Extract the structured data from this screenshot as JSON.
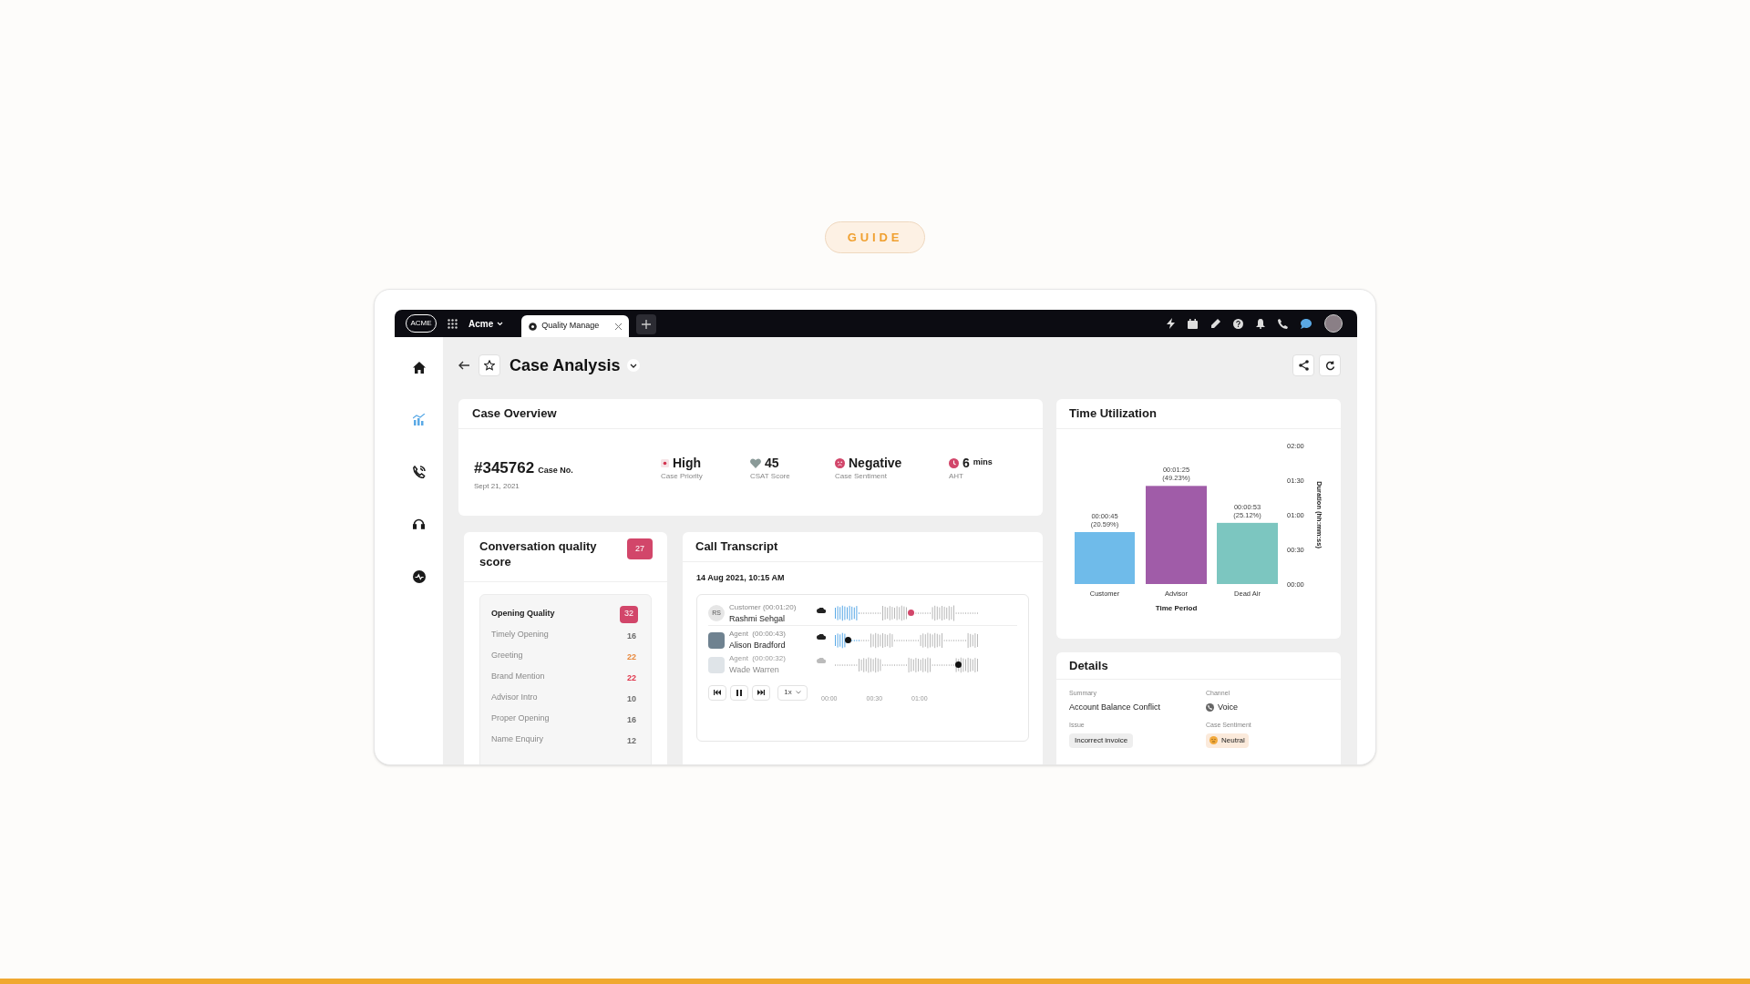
{
  "guide_badge": "GUIDE",
  "top_bar": {
    "logo": "ACME",
    "workspace": "Acme",
    "tabs": [
      {
        "label": "Quality Manage",
        "selected": true
      }
    ]
  },
  "sidebar": {
    "items": [
      {
        "kind": "home",
        "selected": false
      },
      {
        "kind": "chart",
        "selected": true
      },
      {
        "kind": "phone",
        "selected": false
      },
      {
        "kind": "headset",
        "selected": false
      },
      {
        "kind": "activity",
        "selected": false
      }
    ]
  },
  "page_header": {
    "title": "Case Analysis"
  },
  "case_overview": {
    "title": "Case Overview",
    "case_number": "#345762",
    "case_number_label": "Case No.",
    "date": "Sept 21, 2021",
    "metrics": [
      {
        "kind": "priority",
        "value": "High",
        "label": "Case Priority"
      },
      {
        "kind": "csat",
        "value": "45",
        "label": "CSAT Score"
      },
      {
        "kind": "sentiment",
        "value": "Negative",
        "label": "Case Sentiment"
      },
      {
        "kind": "aht",
        "value": "6",
        "unit": "mins",
        "label": "AHT"
      }
    ]
  },
  "conversation_quality": {
    "title": "Conversation quality score",
    "score": "27",
    "group": {
      "name": "Opening Quality",
      "score": "32",
      "items": [
        {
          "name": "Timely Opening",
          "score": "16",
          "color": "#6b6b6b"
        },
        {
          "name": "Greeting",
          "score": "22",
          "color": "#e8873a"
        },
        {
          "name": "Brand Mention",
          "score": "22",
          "color": "#e0344a"
        },
        {
          "name": "Advisor Intro",
          "score": "10",
          "color": "#6b6b6b"
        },
        {
          "name": "Proper Opening",
          "score": "16",
          "color": "#6b6b6b"
        },
        {
          "name": "Name Enquiry",
          "score": "12",
          "color": "#6b6b6b"
        }
      ]
    }
  },
  "call_transcript": {
    "title": "Call Transcript",
    "date": "14 Aug 2021, 10:15 AM",
    "speakers": [
      {
        "kind": "initials",
        "initials": "RS",
        "role": "Customer (00:01:20)",
        "name": "Rashmi Sehgal",
        "dimmed": false,
        "level": 0.53,
        "color": "#d2466a"
      },
      {
        "kind": "photo",
        "role": "Agent  (00:00:43)",
        "name": "Alison Bradford",
        "dimmed": false,
        "level": 0.09,
        "color": "#111111"
      },
      {
        "kind": "photo",
        "role": "Agent  (00:00:32)",
        "name": "Wade Warren",
        "dimmed": true,
        "level": 0.86,
        "color": "#111111"
      }
    ],
    "speed": "1x",
    "ticks": [
      "00:00",
      "00:30",
      "01:00"
    ]
  },
  "time_utilization": {
    "title": "Time Utilization",
    "chart_data": {
      "type": "bar",
      "xlabel": "Time Period",
      "ylabel": "Duration (hh:mm:ss)",
      "categories": [
        "Customer",
        "Advisor",
        "Dead Air"
      ],
      "series": [
        {
          "values": [
            45,
            85,
            53
          ]
        }
      ],
      "colors": [
        "#6fbbea",
        "#a05ca8",
        "#7cc6c0"
      ],
      "ylim": [
        0,
        120
      ],
      "yticks": [
        {
          "value": 0,
          "label": "00:00"
        },
        {
          "value": 30,
          "label": "00:30"
        },
        {
          "value": 60,
          "label": "01:00"
        },
        {
          "value": 90,
          "label": "01:30"
        },
        {
          "value": 120,
          "label": "02:00"
        }
      ],
      "value_labels": [
        "00:00:45 (20.59%)",
        "00:01:25 (49.23%)",
        "00:00:53 (25.12%)"
      ]
    }
  },
  "details": {
    "title": "Details",
    "fields": [
      {
        "kind": "text",
        "label": "Summary",
        "value": "Account Balance Conflict"
      },
      {
        "kind": "channel",
        "label": "Channel",
        "value": "Voice"
      },
      {
        "kind": "chip",
        "label": "Issue",
        "value": "Incorrect invoice"
      },
      {
        "kind": "sentiment",
        "label": "Case Sentiment",
        "value": "Neutral"
      }
    ]
  }
}
